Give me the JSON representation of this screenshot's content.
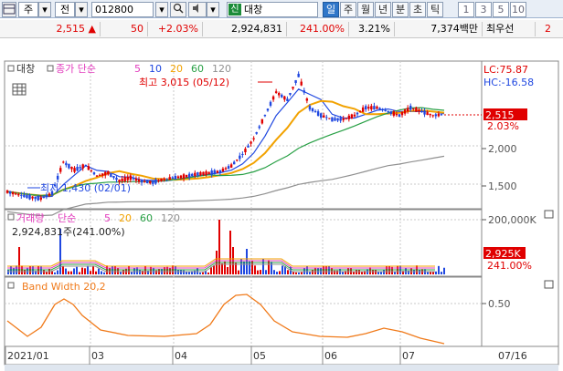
{
  "toolbar": {
    "market": "주",
    "search_type": "전",
    "code": "012800",
    "stock_badge": "신",
    "stock_name": "대창",
    "periods": [
      "일",
      "주",
      "월",
      "년",
      "분",
      "초",
      "틱"
    ],
    "active_period": "일",
    "intervals": [
      "1",
      "3",
      "5",
      "10"
    ]
  },
  "quote": {
    "price": "2,515",
    "change": "50",
    "change_pct": "+2.03%",
    "volume": "2,924,831",
    "volume_ratio": "241.00%",
    "turnover": "3.21%",
    "amount": "7,374백만",
    "extra": "최우선",
    "extra_value": "2",
    "colors": {
      "up": "#e00000"
    }
  },
  "price_panel": {
    "label": "대창",
    "ma_label": "종가 단순",
    "ma_periods": [
      "5",
      "10",
      "20",
      "60",
      "120"
    ],
    "ma_colors": [
      "#e23cbd",
      "#1f47e0",
      "#f2a200",
      "#28a045",
      "#909090"
    ],
    "lc": "LC:75.87",
    "hc": "HC:-16.58",
    "high_note": "최고 3,015 (05/12)",
    "low_note": "최저 1,430 (02/01)",
    "last_price_label": "2,515",
    "last_pct_label": "2.03%",
    "axis": [
      "2,000",
      "1,500"
    ]
  },
  "volume_panel": {
    "label": "거래량",
    "ma_label": "단순",
    "ma_periods": [
      "5",
      "20",
      "60",
      "120"
    ],
    "ma_colors": [
      "#e23cbd",
      "#f2a200",
      "#28a045",
      "#909090"
    ],
    "current": "2,924,831주(241.00%)",
    "axis_top": "200,000K",
    "last_label": "2,925K",
    "last_pct": "241.00%"
  },
  "bw_panel": {
    "label": "Band Width 20,2",
    "axis": "0.50",
    "color": "#f07a1a"
  },
  "x_axis": [
    "2021/01",
    "03",
    "04",
    "05",
    "06",
    "07"
  ],
  "x_right": "07/16",
  "chart_data": {
    "type": "candlestick",
    "x_range": [
      "2021/01",
      "07/16"
    ],
    "price_series_approx": [
      1520,
      1480,
      1450,
      1430,
      1500,
      1900,
      1800,
      1860,
      1720,
      1760,
      1660,
      1700,
      1650,
      1640,
      1680,
      1700,
      1720,
      1750,
      1760,
      1780,
      1850,
      2000,
      2200,
      2500,
      2800,
      2700,
      3015,
      2600,
      2500,
      2450,
      2450,
      2500,
      2600,
      2600,
      2550,
      2500,
      2600,
      2550,
      2500,
      2515
    ],
    "volume_spikes": [
      "2021/02",
      "2021/04 late",
      "2021/05 early"
    ],
    "bandwidth_peaks": [
      "02",
      "05",
      "07"
    ]
  }
}
